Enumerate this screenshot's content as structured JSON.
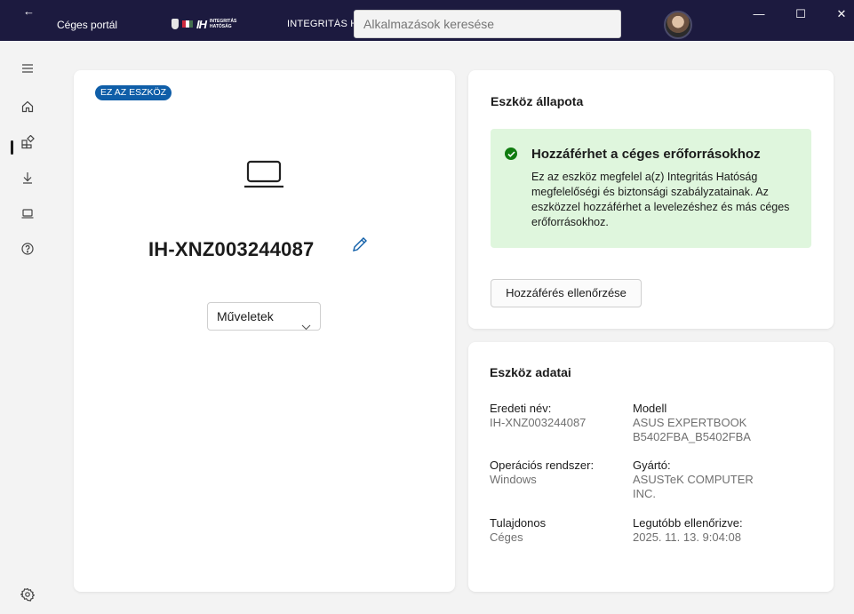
{
  "titlebar": {
    "app_name": "Céges portál",
    "logo_line1": "INTEGRITÁS",
    "logo_line2": "HATÓSÁG",
    "logo_mark": "IH",
    "org_name": "INTEGRITÁS HATÓSÁG",
    "search_placeholder": "Alkalmazások keresése",
    "back_icon": "←",
    "minimize_icon": "—",
    "maximize_icon": "☐",
    "close_icon": "✕"
  },
  "rail": {
    "items": [
      "menu-icon",
      "home-icon",
      "apps-icon",
      "download-icon",
      "device-icon",
      "help-icon",
      "settings-icon"
    ]
  },
  "device_card": {
    "badge": "EZ AZ ESZKÖZ",
    "device_name": "IH-XNZ003244087",
    "actions_label": "Műveletek"
  },
  "status_card": {
    "title": "Eszköz állapota",
    "status_heading": "Hozzáférhet a céges erőforrásokhoz",
    "status_body": "Ez az eszköz megfelel a(z) Integritás Hatóság megfelelőségi és biztonsági szabályzatainak. Az eszközzel hozzáférhet a levelezéshez és más céges erőforrásokhoz.",
    "check_button": "Hozzáférés ellenőrzése"
  },
  "details_card": {
    "title": "Eszköz adatai",
    "fields": {
      "original_name": {
        "label": "Eredeti név:",
        "value": "IH-XNZ003244087"
      },
      "model": {
        "label": "Modell",
        "value": "ASUS EXPERTBOOK B5402FBA_B5402FBA"
      },
      "os": {
        "label": "Operációs rendszer:",
        "value": "Windows"
      },
      "manufacturer": {
        "label": "Gyártó:",
        "value": "ASUSTeK COMPUTER INC."
      },
      "owner": {
        "label": "Tulajdonos",
        "value": "Céges"
      },
      "last_checked": {
        "label": "Legutóbb ellenőrizve:",
        "value": "2025. 11. 13. 9:04:08"
      }
    }
  },
  "colors": {
    "titlebar_bg": "#1c1a3f",
    "badge_bg": "#0f5ea8",
    "status_bg": "#dff6dd",
    "status_ok": "#107c10",
    "accent": "#0f5ea8"
  }
}
